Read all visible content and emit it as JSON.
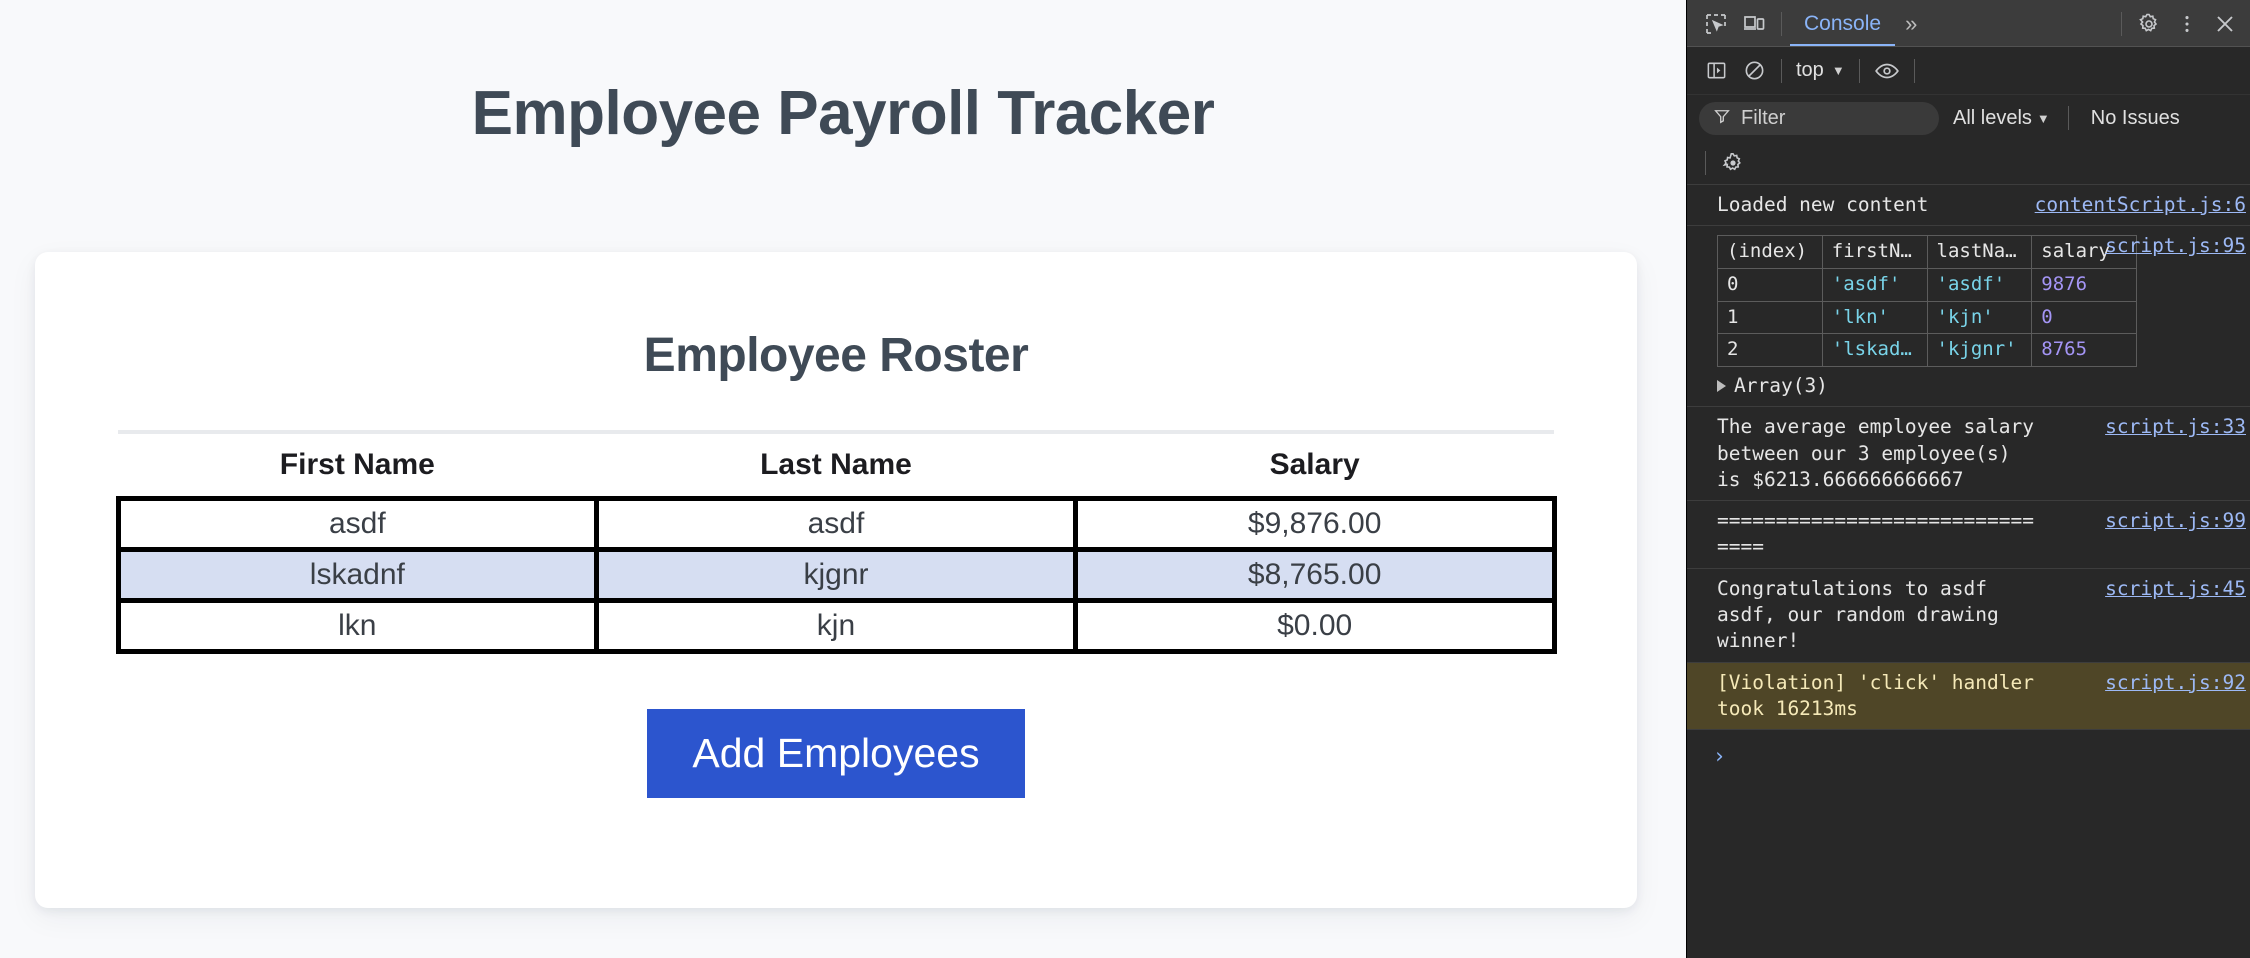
{
  "page": {
    "title": "Employee Payroll Tracker",
    "card": {
      "heading": "Employee Roster",
      "table": {
        "headers": [
          "First Name",
          "Last Name",
          "Salary"
        ],
        "rows": [
          {
            "first": "asdf",
            "last": "asdf",
            "salary": "$9,876.00",
            "highlighted": false
          },
          {
            "first": "lskadnf",
            "last": "kjgnr",
            "salary": "$8,765.00",
            "highlighted": true
          },
          {
            "first": "lkn",
            "last": "kjn",
            "salary": "$0.00",
            "highlighted": false
          }
        ]
      },
      "add_button_label": "Add Employees"
    }
  },
  "devtools": {
    "tabbar": {
      "inspect_icon": "inspect-element-icon",
      "device_icon": "device-toolbar-icon",
      "active_tab": "Console",
      "more_tabs": "»",
      "settings_icon": "gear-icon",
      "kebab_icon": "more-options-icon",
      "close_icon": "close-icon"
    },
    "console_toolbar": {
      "sidebar_icon": "console-sidebar-icon",
      "clear_icon": "clear-console-icon",
      "context": "top",
      "eye_icon": "live-expression-icon"
    },
    "filterbar": {
      "filter_icon": "filter-icon",
      "filter_placeholder": "Filter",
      "filter_value": "",
      "levels": "All levels",
      "issues": "No Issues"
    },
    "settings_row": {
      "gear_icon": "console-settings-icon"
    },
    "messages": [
      {
        "kind": "log",
        "text": "Loaded new content",
        "url": "contentScript.js:6"
      },
      {
        "kind": "table",
        "text": "",
        "url": "script.js:95",
        "table": {
          "headers": [
            "(index)",
            "firstN…",
            "lastNa…",
            "salary"
          ],
          "rows": [
            {
              "index": "0",
              "first": "'asdf'",
              "last": "'asdf'",
              "salary": "9876"
            },
            {
              "index": "1",
              "first": "'lkn'",
              "last": "'kjn'",
              "salary": "0"
            },
            {
              "index": "2",
              "first": "'lskad…",
              "last": "'kjgnr'",
              "salary": "8765"
            }
          ],
          "footer": "Array(3)"
        }
      },
      {
        "kind": "log",
        "text": "The average employee salary between our 3 employee(s) is $6213.666666666667",
        "url": "script.js:33"
      },
      {
        "kind": "log",
        "text": "===============================",
        "url": "script.js:99"
      },
      {
        "kind": "log",
        "text": "Congratulations to asdf asdf, our random drawing winner!",
        "url": "script.js:45"
      },
      {
        "kind": "violation",
        "text": "[Violation] 'click' handler took 16213ms",
        "url": "script.js:92"
      }
    ],
    "prompt_symbol": "›"
  },
  "colors": {
    "accent_blue": "#2c55ce",
    "heading_slate": "#3f4a56",
    "row_highlight": "#d6def2",
    "devtools_bg": "#282828",
    "devtools_tabbar": "#3c3c3c",
    "link_blue": "#9db9f5",
    "violation_bg": "#4f4627"
  }
}
